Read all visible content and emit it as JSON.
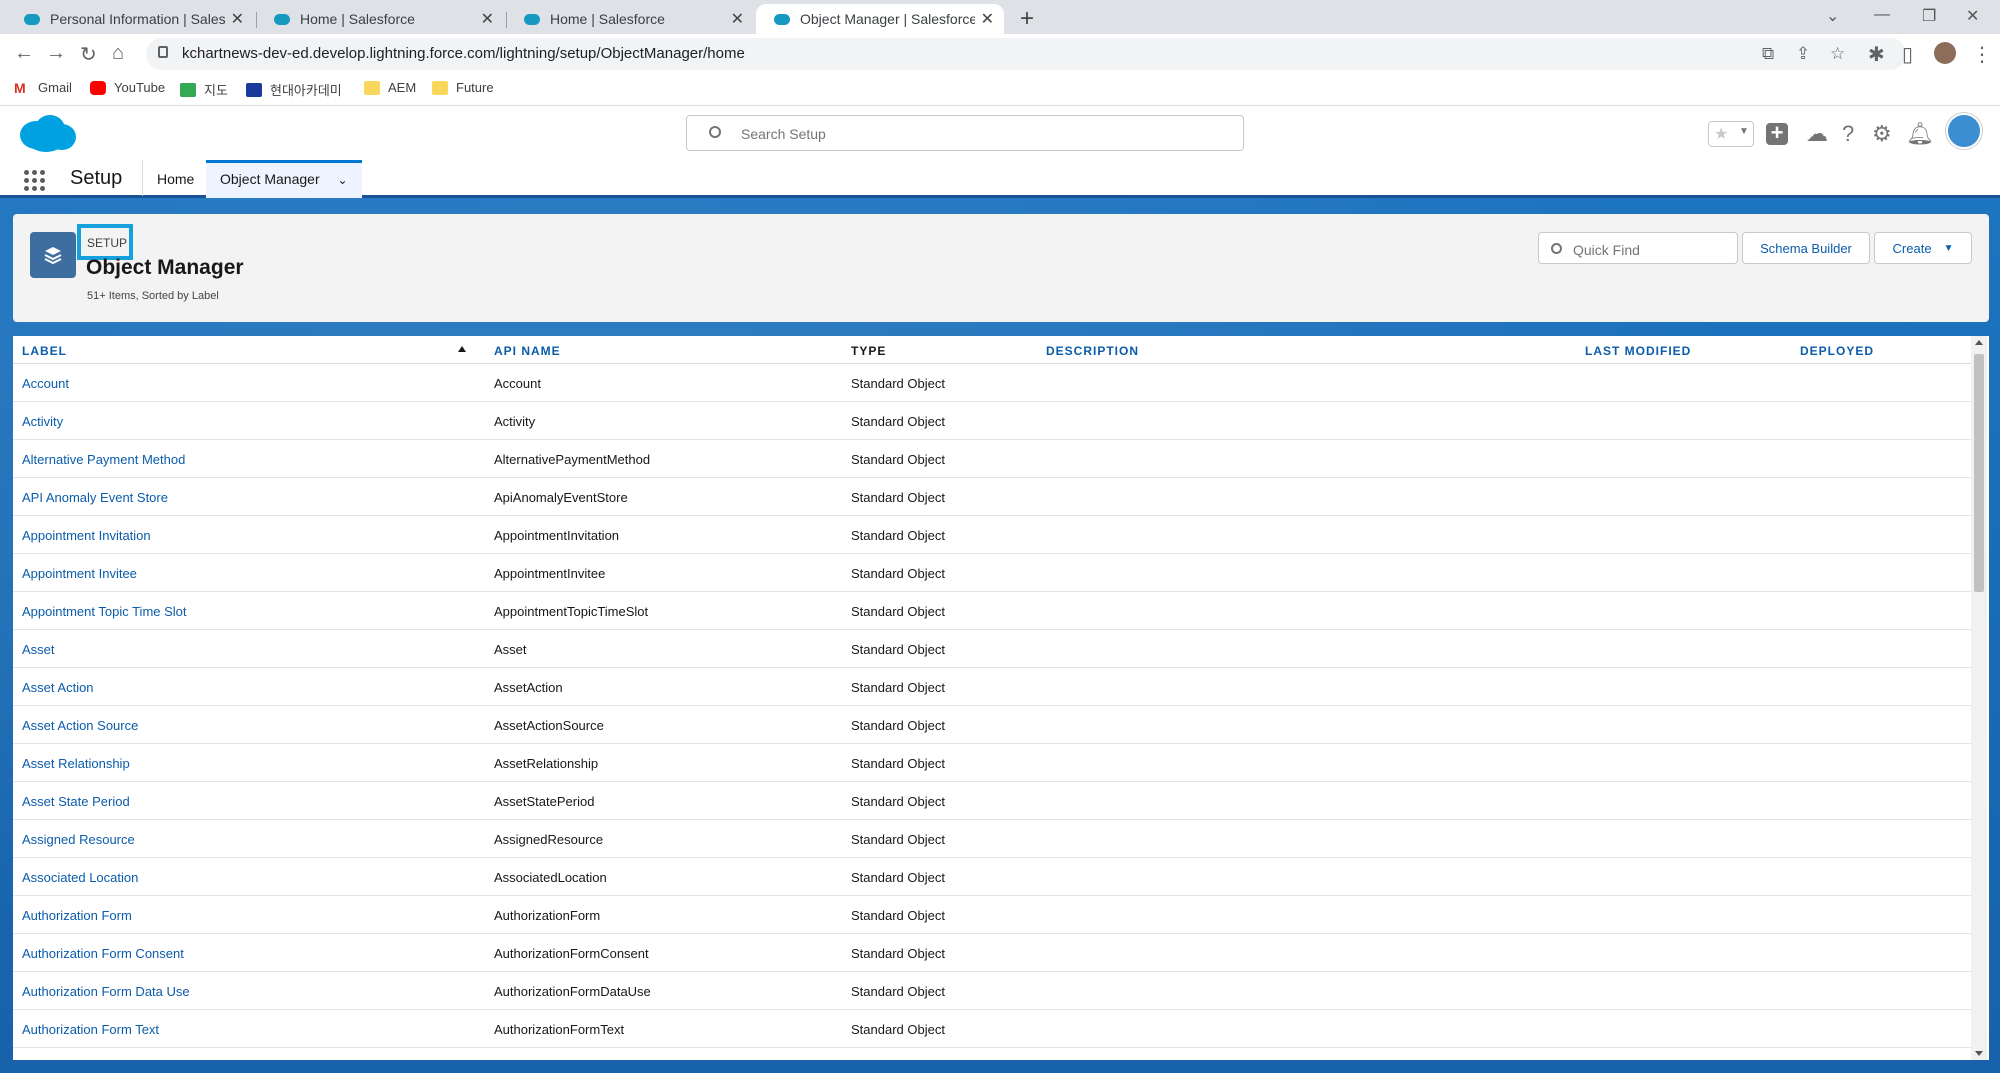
{
  "browser": {
    "tabs": [
      {
        "title": "Personal Information | Salesforce",
        "active": false
      },
      {
        "title": "Home | Salesforce",
        "active": false
      },
      {
        "title": "Home | Salesforce",
        "active": false
      },
      {
        "title": "Object Manager | Salesforce",
        "active": true
      }
    ],
    "url": "kchartnews-dev-ed.develop.lightning.force.com/lightning/setup/ObjectManager/home",
    "bookmarks": [
      "Gmail",
      "YouTube",
      "지도",
      "현대아카데미",
      "AEM",
      "Future"
    ]
  },
  "header": {
    "search_placeholder": "Search Setup"
  },
  "nav": {
    "app_name": "Setup",
    "items": [
      "Home",
      "Object Manager"
    ]
  },
  "page": {
    "breadcrumb": "SETUP",
    "title": "Object Manager",
    "subtitle": "51+ Items, Sorted by Label",
    "quick_find_placeholder": "Quick Find",
    "schema_builder": "Schema Builder",
    "create": "Create"
  },
  "table": {
    "columns": [
      "LABEL",
      "API NAME",
      "TYPE",
      "DESCRIPTION",
      "LAST MODIFIED",
      "DEPLOYED"
    ],
    "rows": [
      {
        "label": "Account",
        "api": "Account",
        "type": "Standard Object"
      },
      {
        "label": "Activity",
        "api": "Activity",
        "type": "Standard Object"
      },
      {
        "label": "Alternative Payment Method",
        "api": "AlternativePaymentMethod",
        "type": "Standard Object"
      },
      {
        "label": "API Anomaly Event Store",
        "api": "ApiAnomalyEventStore",
        "type": "Standard Object"
      },
      {
        "label": "Appointment Invitation",
        "api": "AppointmentInvitation",
        "type": "Standard Object"
      },
      {
        "label": "Appointment Invitee",
        "api": "AppointmentInvitee",
        "type": "Standard Object"
      },
      {
        "label": "Appointment Topic Time Slot",
        "api": "AppointmentTopicTimeSlot",
        "type": "Standard Object"
      },
      {
        "label": "Asset",
        "api": "Asset",
        "type": "Standard Object"
      },
      {
        "label": "Asset Action",
        "api": "AssetAction",
        "type": "Standard Object"
      },
      {
        "label": "Asset Action Source",
        "api": "AssetActionSource",
        "type": "Standard Object"
      },
      {
        "label": "Asset Relationship",
        "api": "AssetRelationship",
        "type": "Standard Object"
      },
      {
        "label": "Asset State Period",
        "api": "AssetStatePeriod",
        "type": "Standard Object"
      },
      {
        "label": "Assigned Resource",
        "api": "AssignedResource",
        "type": "Standard Object"
      },
      {
        "label": "Associated Location",
        "api": "AssociatedLocation",
        "type": "Standard Object"
      },
      {
        "label": "Authorization Form",
        "api": "AuthorizationForm",
        "type": "Standard Object"
      },
      {
        "label": "Authorization Form Consent",
        "api": "AuthorizationFormConsent",
        "type": "Standard Object"
      },
      {
        "label": "Authorization Form Data Use",
        "api": "AuthorizationFormDataUse",
        "type": "Standard Object"
      },
      {
        "label": "Authorization Form Text",
        "api": "AuthorizationFormText",
        "type": "Standard Object"
      }
    ]
  }
}
